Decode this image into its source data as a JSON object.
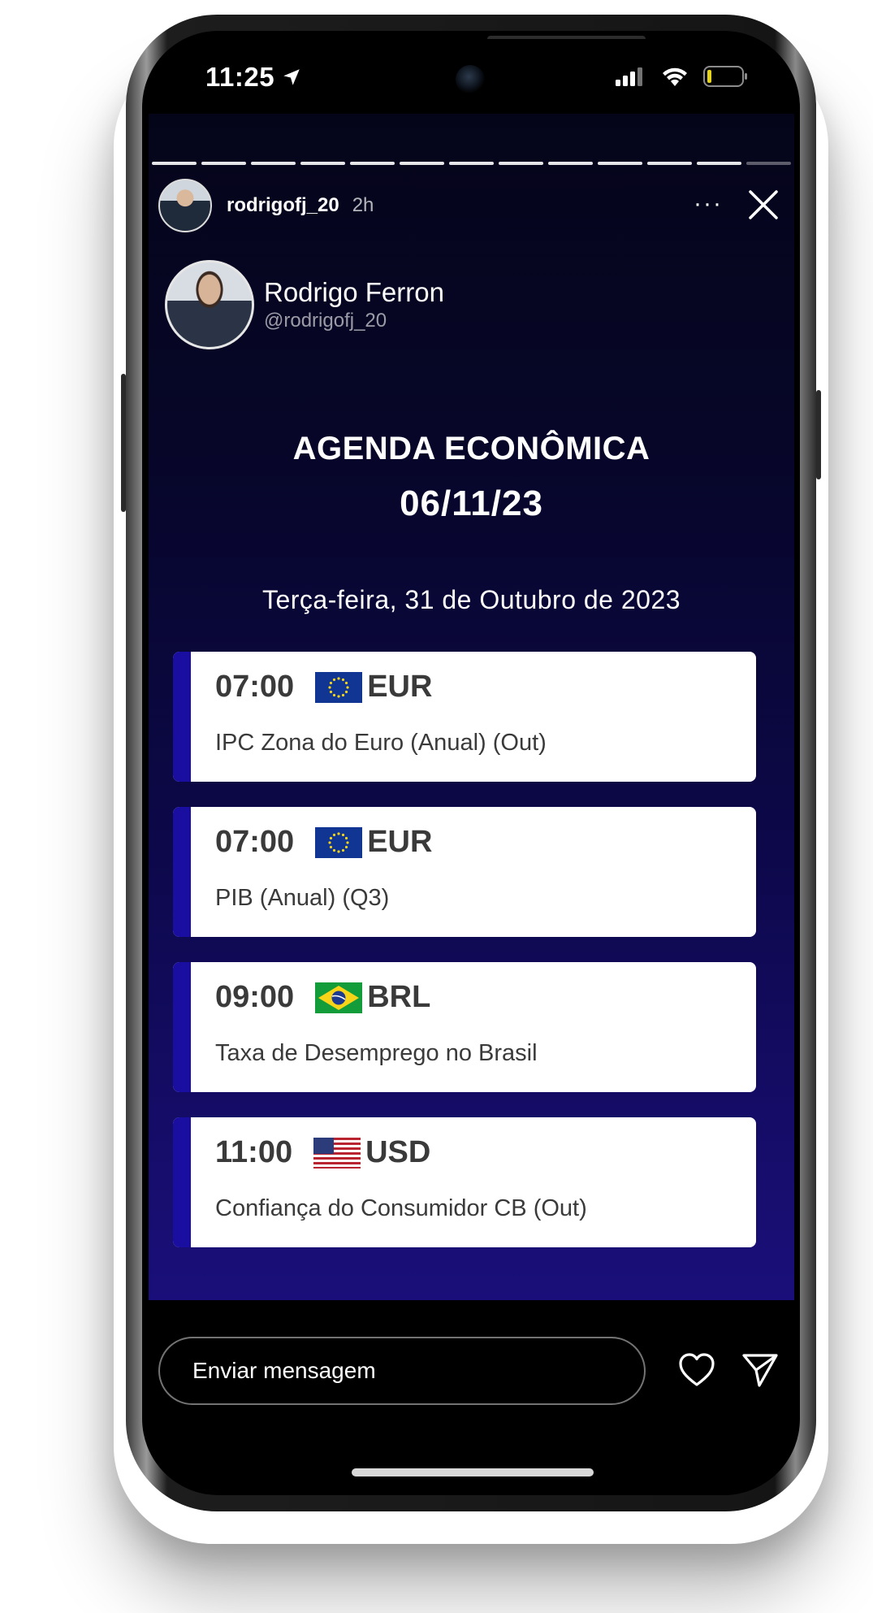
{
  "status_bar": {
    "time": "11:25",
    "icons": [
      "location-arrow-icon",
      "signal-icon",
      "wifi-icon",
      "battery-icon"
    ]
  },
  "story": {
    "progress_segments": 13,
    "progress_viewed": 12,
    "header": {
      "username": "rodrigofj_20",
      "time_ago": "2h",
      "more_label": "···"
    },
    "author": {
      "name": "Rodrigo Ferron",
      "handle": "@rodrigofj_20"
    },
    "title_line1": "AGENDA ECONÔMICA",
    "title_line2": "06/11/23",
    "date_line": "Terça-feira, 31 de Outubro de 2023",
    "events": [
      {
        "time": "07:00",
        "currency": "EUR",
        "flag": "eu-flag-icon",
        "description": "IPC Zona do Euro (Anual) (Out)"
      },
      {
        "time": "07:00",
        "currency": "EUR",
        "flag": "eu-flag-icon",
        "description": "PIB (Anual) (Q3)"
      },
      {
        "time": "09:00",
        "currency": "BRL",
        "flag": "brazil-flag-icon",
        "description": "Taxa de Desemprego no Brasil"
      },
      {
        "time": "11:00",
        "currency": "USD",
        "flag": "us-flag-icon",
        "description": "Confiança do Consumidor CB (Out)"
      }
    ]
  },
  "reply": {
    "placeholder": "Enviar mensagem"
  },
  "colors": {
    "story_bg_top": "#05051a",
    "story_bg_bottom": "#1a0f7a",
    "card_accent": "#1a0ea0",
    "card_text": "#3a3a3a"
  }
}
